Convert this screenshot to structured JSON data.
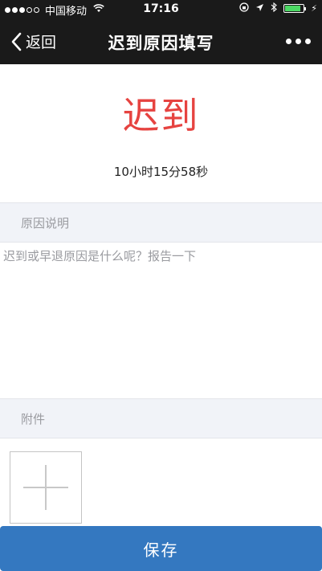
{
  "status_bar": {
    "carrier": "中国移动",
    "time": "17:16",
    "battery_level": 0.85,
    "signal_strength": "3 of 5"
  },
  "nav": {
    "back_label": "返回",
    "title": "迟到原因填写"
  },
  "main": {
    "status_title": "迟到",
    "status_color": "#e64340",
    "duration": "10小时15分58秒"
  },
  "reason": {
    "section_label": "原因说明",
    "placeholder": "迟到或早退原因是什么呢？报告一下",
    "value": ""
  },
  "attachment": {
    "section_label": "附件"
  },
  "actions": {
    "save_label": "保存",
    "save_color": "#3478c0"
  }
}
